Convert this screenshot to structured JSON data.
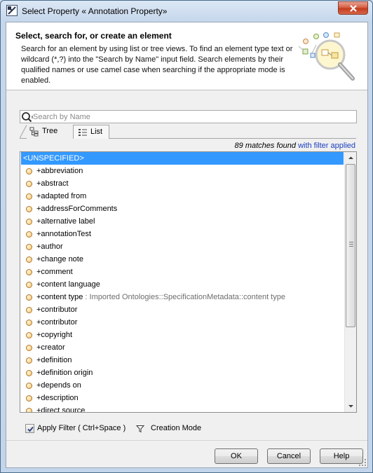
{
  "window": {
    "title": "Select Property « Annotation Property»"
  },
  "header": {
    "title": "Select, search for, or create an element",
    "description": "Search for an element by using list or tree views. To find an element type text or wildcard (*,?) into the \"Search by Name\" input field. Search elements by their qualified names or use camel case when searching if the appropriate mode is enabled."
  },
  "search": {
    "placeholder": "Search by Name",
    "value": ""
  },
  "tabs": [
    {
      "label": "Tree",
      "icon": "tree-icon",
      "active": false
    },
    {
      "label": "List",
      "icon": "list-icon",
      "active": true
    }
  ],
  "matches": {
    "count_text": "89 matches found",
    "filter_text": "with filter applied"
  },
  "list": {
    "items": [
      {
        "label": "<UNSPECIFIED>",
        "qualifier": "",
        "selected": true
      },
      {
        "label": "+abbreviation",
        "qualifier": ""
      },
      {
        "label": "+abstract",
        "qualifier": ""
      },
      {
        "label": "+adapted from",
        "qualifier": ""
      },
      {
        "label": "+addressForComments",
        "qualifier": ""
      },
      {
        "label": "+alternative label",
        "qualifier": ""
      },
      {
        "label": "+annotationTest",
        "qualifier": ""
      },
      {
        "label": "+author",
        "qualifier": ""
      },
      {
        "label": "+change note",
        "qualifier": ""
      },
      {
        "label": "+comment",
        "qualifier": ""
      },
      {
        "label": "+content language",
        "qualifier": ""
      },
      {
        "label": "+content type",
        "qualifier": " : Imported Ontologies::SpecificationMetadata::content type"
      },
      {
        "label": "+contributor",
        "qualifier": ""
      },
      {
        "label": "+contributor",
        "qualifier": ""
      },
      {
        "label": "+copyright",
        "qualifier": ""
      },
      {
        "label": "+creator",
        "qualifier": ""
      },
      {
        "label": "+definition",
        "qualifier": ""
      },
      {
        "label": "+definition origin",
        "qualifier": ""
      },
      {
        "label": "+depends on",
        "qualifier": ""
      },
      {
        "label": "+description",
        "qualifier": ""
      },
      {
        "label": "+direct source",
        "qualifier": ""
      }
    ]
  },
  "filter": {
    "apply_label": "Apply Filter ( Ctrl+Space )",
    "apply_checked": true,
    "creation_mode_label": "Creation Mode"
  },
  "buttons": {
    "ok": "OK",
    "cancel": "Cancel",
    "help": "Help"
  }
}
